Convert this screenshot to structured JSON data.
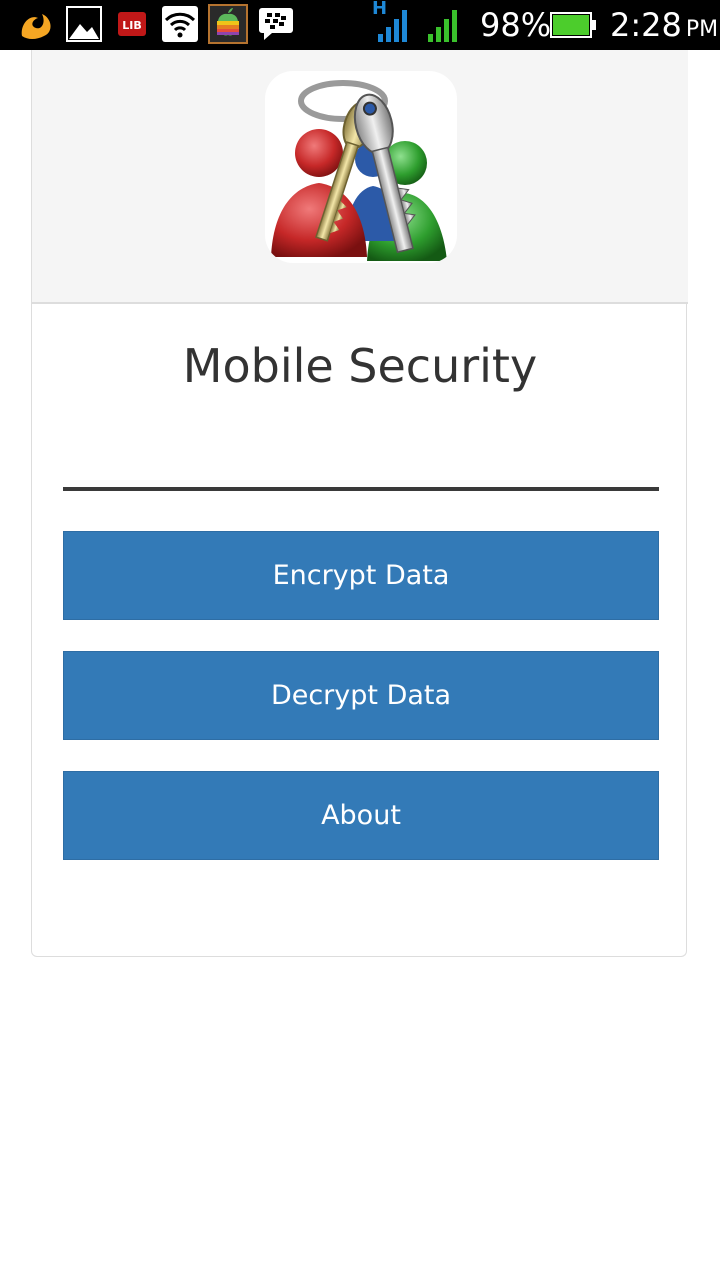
{
  "status_bar": {
    "battery_percent": "98%",
    "time": "2:28",
    "ampm": "PM",
    "network_type": "H",
    "battery_level": 0.98,
    "icons": [
      "uc-browser-icon",
      "gallery-icon",
      "lib-icon",
      "wifi-icon",
      "apple-app-icon",
      "blackberry-messenger-icon",
      "signal-icon",
      "signal-icon-2",
      "battery-icon"
    ],
    "colors": {
      "signal_blue": "#1e88d6",
      "signal_green": "#3ac12c",
      "battery_green": "#4ccd2c"
    }
  },
  "header": {
    "logo_icon": "keys-users-logo-icon"
  },
  "main": {
    "title": "Mobile Security",
    "buttons": {
      "encrypt": "Encrypt Data",
      "decrypt": "Decrypt Data",
      "about": "About"
    }
  },
  "colors": {
    "button_bg": "#337ab7",
    "header_bg": "#f5f5f5",
    "title_text": "#333333"
  }
}
